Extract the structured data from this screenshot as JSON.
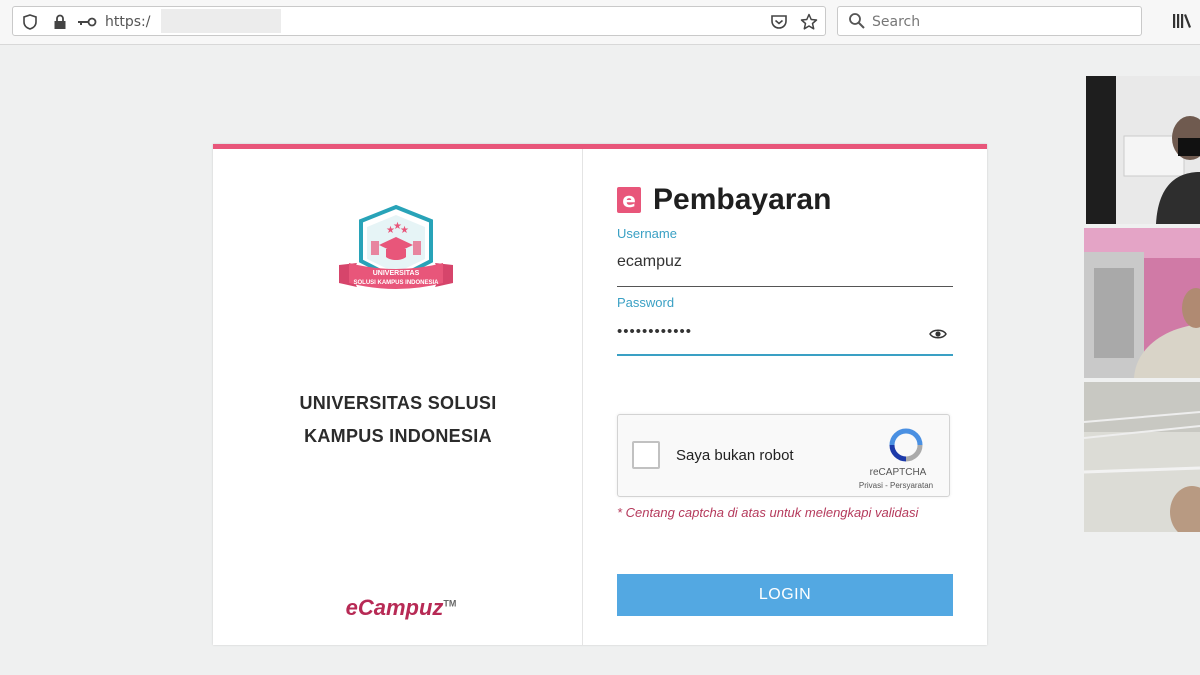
{
  "browser": {
    "url": "https:/",
    "search_placeholder": "Search"
  },
  "left": {
    "logo": {
      "line1": "UNIVERSITAS",
      "line2": "SOLUSI KAMPUS INDONESIA"
    },
    "university_line1": "UNIVERSITAS SOLUSI",
    "university_line2": "KAMPUS INDONESIA",
    "brand": "eCampuz",
    "brand_tm": "TM"
  },
  "right": {
    "app_badge": "e",
    "app_title": "Pembayaran",
    "username_label": "Username",
    "username_value": "ecampuz",
    "password_label": "Password",
    "password_value": "••••••••••••",
    "captcha_label": "Saya bukan robot",
    "captcha_brand": "reCAPTCHA",
    "captcha_links": "Privasi - Persyaratan",
    "captcha_note": "* Centang captcha di atas untuk melengkapi validasi",
    "login_label": "LOGIN"
  },
  "colors": {
    "accent_pink": "#e8567a",
    "label_blue": "#3aa0c4",
    "button_blue": "#53a8e2",
    "note_red": "#b53a5c"
  }
}
